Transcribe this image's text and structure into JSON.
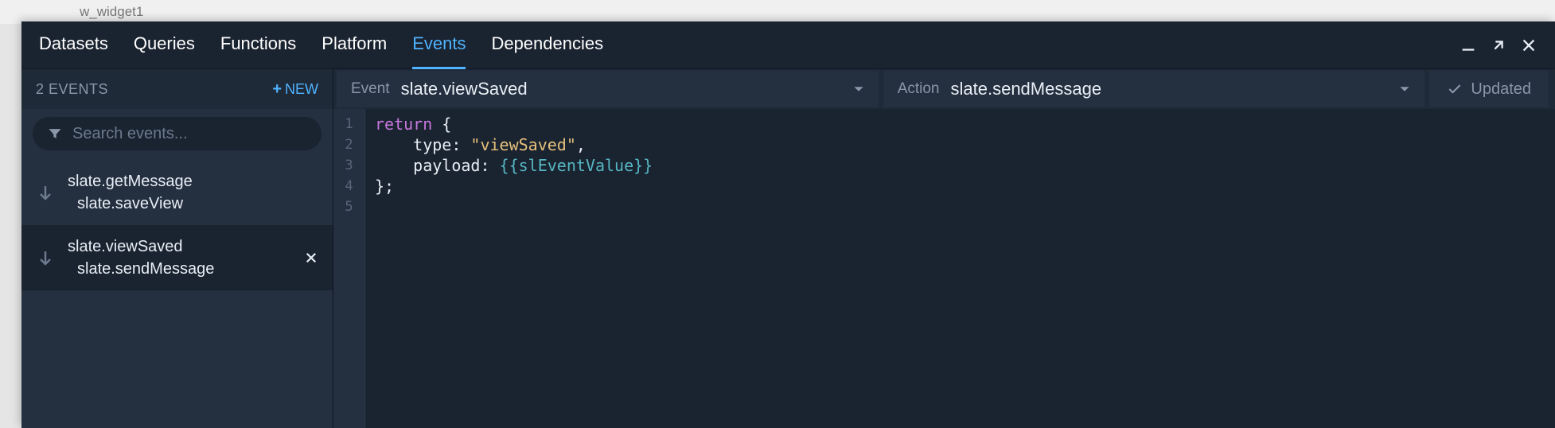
{
  "back_crumb": "w_widget1",
  "tabs": {
    "items": [
      "Datasets",
      "Queries",
      "Functions",
      "Platform",
      "Events",
      "Dependencies"
    ],
    "active": "Events"
  },
  "sidebar": {
    "count_label": "2 EVENTS",
    "new_label": "NEW",
    "search_placeholder": "Search events..."
  },
  "events": [
    {
      "event": "slate.getMessage",
      "action": "slate.saveView",
      "selected": false
    },
    {
      "event": "slate.viewSaved",
      "action": "slate.sendMessage",
      "selected": true
    }
  ],
  "config": {
    "event_label": "Event",
    "event_value": "slate.viewSaved",
    "action_label": "Action",
    "action_value": "slate.sendMessage",
    "status": "Updated"
  },
  "code": {
    "lines": [
      [
        {
          "t": "keyword",
          "v": "return"
        },
        {
          "t": "plain",
          "v": " "
        },
        {
          "t": "brace",
          "v": "{"
        }
      ],
      [
        {
          "t": "plain",
          "v": "    type: "
        },
        {
          "t": "string",
          "v": "\"viewSaved\""
        },
        {
          "t": "plain",
          "v": ","
        }
      ],
      [
        {
          "t": "plain",
          "v": "    payload: "
        },
        {
          "t": "var",
          "v": "{{slEventValue}}"
        }
      ],
      [
        {
          "t": "brace",
          "v": "};"
        }
      ],
      []
    ]
  }
}
